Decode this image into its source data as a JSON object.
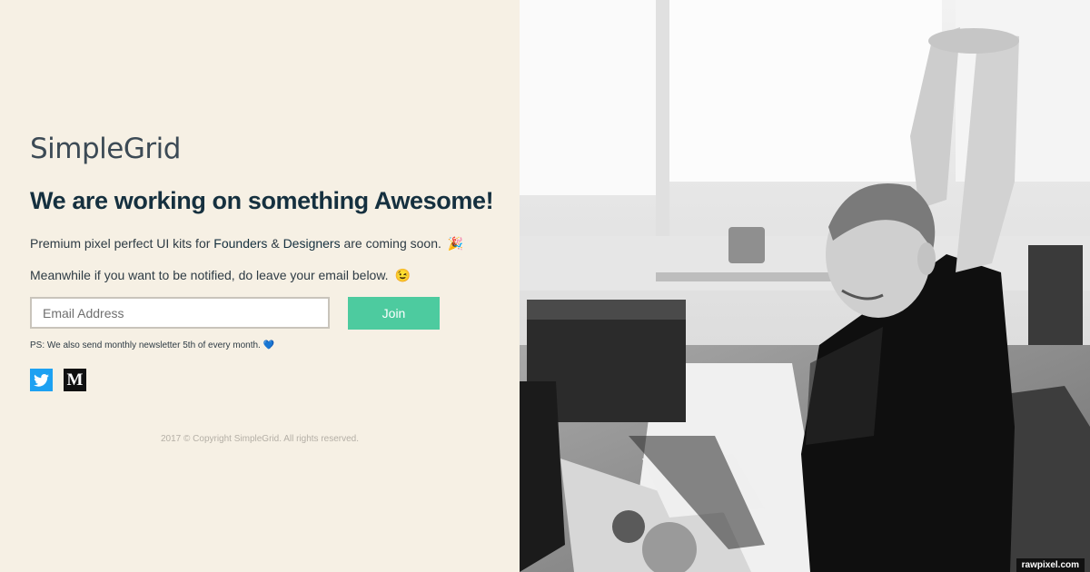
{
  "brand": {
    "logo_text": "SimpleGrid"
  },
  "hero": {
    "headline": "We are working on something Awesome!",
    "line1_prefix": "Premium pixel perfect UI kits for ",
    "line1_founders": "Founders",
    "line1_amp": " & ",
    "line1_designers": "Designers",
    "line1_suffix": " are coming soon.",
    "line1_emoji": "🎉",
    "line2_text": "Meanwhile if you want to be notified, do leave your email below.",
    "line2_emoji": "😉"
  },
  "signup": {
    "email_placeholder": "Email Address",
    "join_label": "Join"
  },
  "note": {
    "text": "PS: We also send monthly newsletter 5th of every month.",
    "emoji": "💙"
  },
  "social": {
    "medium_glyph": "M"
  },
  "footer": {
    "copyright": "2017 © Copyright SimpleGrid. All rights reserved."
  },
  "photo": {
    "watermark": "rawpixel.com"
  },
  "colors": {
    "background": "#f6f0e4",
    "accent": "#4dcb9f",
    "heading": "#15303f",
    "twitter": "#1da1f2"
  }
}
